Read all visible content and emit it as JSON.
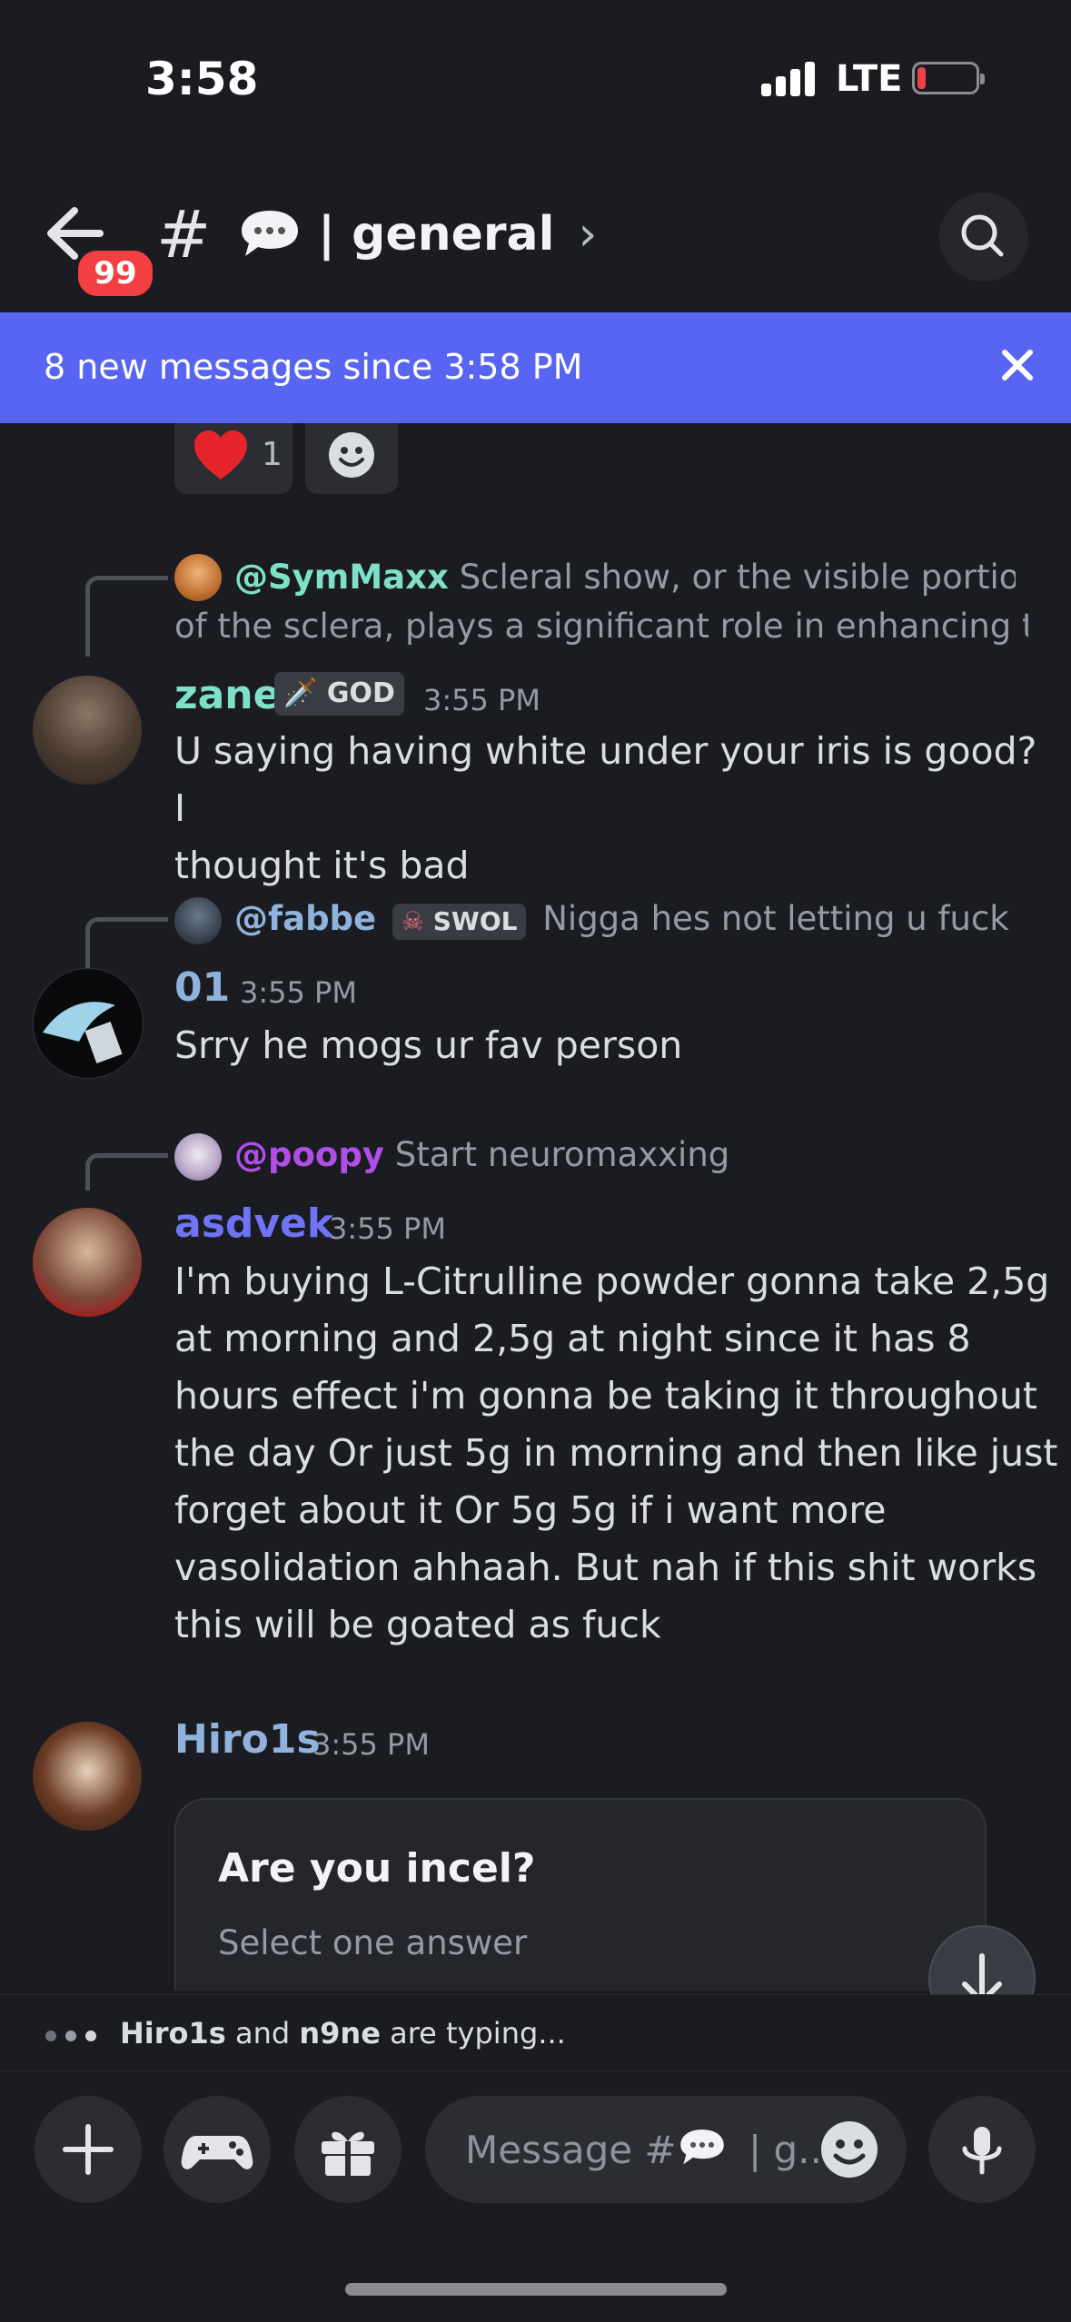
{
  "status_bar": {
    "time": "3:58",
    "network": "LTE"
  },
  "header": {
    "badge": "99",
    "hash": "#",
    "channel": "| general",
    "chevron": "›"
  },
  "banner": {
    "text": "8 new messages since 3:58 PM",
    "close": "✕"
  },
  "reactions": [
    {
      "emoji": "❤️",
      "count": "1"
    }
  ],
  "messages": [
    {
      "reply": {
        "user": "@SymMaxx",
        "text_line1": "Scleral show, or the visible portion",
        "text_line2": "of the sclera, plays a significant role in enhancing t..."
      },
      "user": "zane",
      "user_color": "#7fe0c8",
      "tag": "GOD",
      "time": "3:55 PM",
      "lines": [
        "U saying having white under your iris is good? I",
        "thought it's bad"
      ]
    },
    {
      "reply": {
        "user": "@fabbe",
        "tag": "SWOL",
        "text": "Nigga hes not letting u fuck"
      },
      "user": "01",
      "user_color": "#8fb3dc",
      "time": "3:55 PM",
      "lines": [
        "Srry he mogs ur fav person"
      ]
    },
    {
      "reply": {
        "user": "@poopy",
        "text": "Start neuromaxxing"
      },
      "user": "asdvek",
      "user_color": "#6e74f5",
      "time": "3:55 PM",
      "lines": [
        "I'm buying L-Citrulline powder gonna take 2,5g",
        "at morning and 2,5g at night since it has 8",
        "hours effect i'm gonna be taking it throughout",
        "the day Or just 5g in morning and then like just",
        "forget about it Or 5g 5g if i want more",
        "vasolidation ahhaah. But nah if this shit works",
        "this will be goated as fuck"
      ]
    },
    {
      "user": "Hiro1s",
      "user_color": "#8fb3dc",
      "time": "3:55 PM",
      "poll": {
        "question": "Are you incel?",
        "subtitle": "Select one answer"
      }
    }
  ],
  "typing": {
    "user1": "Hiro1s",
    "and": " and ",
    "user2": "n9ne",
    "suffix": " are typing..."
  },
  "composer": {
    "placeholder": "Message #",
    "placeholder_tail": "| g.."
  },
  "colors": {
    "blurple": "#5865f2",
    "background": "#1b1c21",
    "poopy": "#b14ee8",
    "symmaxx": "#7fe0c8",
    "fabbe": "#8fb3dc"
  }
}
